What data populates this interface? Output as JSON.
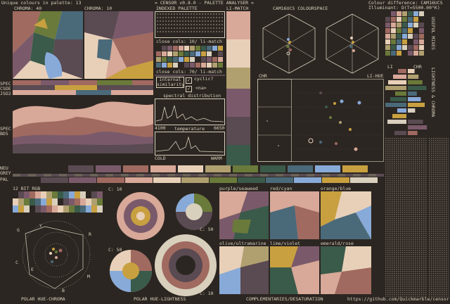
{
  "header": {
    "unique_colours": "Unique colours in palette: 13",
    "title": "= CENSOR v0.8.0 - PALETTE ANALYSER =",
    "colour_difference": "Colour difference: CAM16UCS",
    "illuminant": "Illuminant: D(T=5500.00°K)"
  },
  "labels": {
    "chroma40": "CHROMA: 40",
    "chroma10": "CHROMA: 10",
    "indexed_palette": "INDEXED PALETTE",
    "li_match": "LI-MATCH",
    "colourspace": "CAM16UCS COLOURSPACE",
    "spec1": "SPEC",
    "spec2": "CSDE",
    "spec3": "JSD2",
    "spec4": "SPEC",
    "spec5": "BD5",
    "close_cols1": "close cols: 10/ li-match",
    "close_cols2": "close cols: 70/ li-match",
    "internal_similarity": "internal similarity",
    "cyclic": "cyclic?",
    "na": "<na>",
    "spectral_distribution": "spectral distribution",
    "spec_min": "4100",
    "spec_max": "6650",
    "temperature": "temperature",
    "cold": "COLD",
    "warm": "WARM",
    "chr": "CHR",
    "li_hue": "LI-HUE",
    "li": "LI",
    "chr2": "CHR",
    "neu": "NEU",
    "grey": "GREY",
    "pal": "PAL",
    "bit12": "12 BIT RGB",
    "c10a": "C: 10",
    "c50a": "C: 50",
    "c50b": "C: 50",
    "c10b": "C: 10",
    "purple_seaweed": "purple/seaweed",
    "red_cyan": "red/cyan",
    "orange_blue": "orange/blue",
    "olive_ultramarine": "olive/ultramarine",
    "lime_violet": "lime/violet",
    "emerald_rose": "emerald/rose",
    "polar_hue_chroma": "POLAR HUE-CHROMA",
    "polar_hue_lightness": "POLAR HUE-LIGHTNESS",
    "complementaries": "COMPLEMENTARIES/DESATURATION",
    "github": "https://github.com/Quickmarble/censor",
    "useful_mixes": "USEFUL MIXES",
    "lightness_chroma": "LIGHTNESS & CHROMA",
    "hue_g": "G",
    "hue_y": "Y",
    "hue_r": "R",
    "hue_c": "C",
    "hue_m": "M",
    "hue_b": "B",
    "hue_e": "E"
  },
  "palette": [
    "#2c2622",
    "#5a4a52",
    "#7a5a6a",
    "#a06a60",
    "#d8a898",
    "#e8d0b8",
    "#b0a070",
    "#6a7a3a",
    "#3a5a4a",
    "#4a6a7a",
    "#88aad8",
    "#c8a040",
    "#d8d0bc"
  ],
  "colors": {
    "bg": "#2c2622",
    "fg": "#d8d0bc",
    "accent": "#a06a60"
  }
}
